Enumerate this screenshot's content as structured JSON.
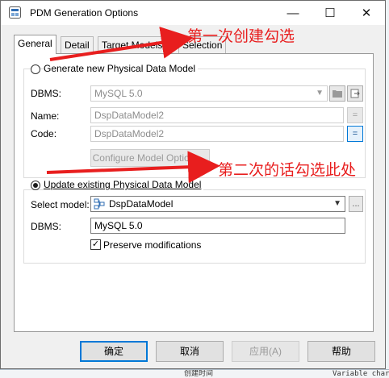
{
  "window": {
    "title": "PDM Generation Options",
    "minimize": "—",
    "maximize": "☐",
    "close": "✕"
  },
  "tabs": [
    {
      "label": "General"
    },
    {
      "label": "Detail"
    },
    {
      "label": "Target Models"
    },
    {
      "label": "Selection"
    }
  ],
  "generate_new": {
    "label": "Generate new Physical Data Model",
    "dbms_label": "DBMS:",
    "dbms_value": "MySQL 5.0",
    "name_label": "Name:",
    "name_value": "DspDataModel2",
    "code_label": "Code:",
    "code_value": "DspDataModel2",
    "equals": "=",
    "configure_button": "Configure Model Options..."
  },
  "update_existing": {
    "label": "Update existing Physical Data Model",
    "select_model_label": "Select model:",
    "select_model_value": "DspDataModel",
    "browse": "...",
    "dbms_label": "DBMS:",
    "dbms_value": "MySQL 5.0",
    "preserve_label": "Preserve modifications",
    "preserve_checked": "✓"
  },
  "annotations": {
    "first": "第一次创建勾选",
    "second": "第二次的话勾选此处",
    "color": "#e81e1e"
  },
  "buttons": {
    "ok": "确定",
    "cancel": "取消",
    "apply": "应用(A)",
    "help": "帮助"
  },
  "background": {
    "bottom_left": "创建时间",
    "bottom_right": "Variable characters"
  }
}
